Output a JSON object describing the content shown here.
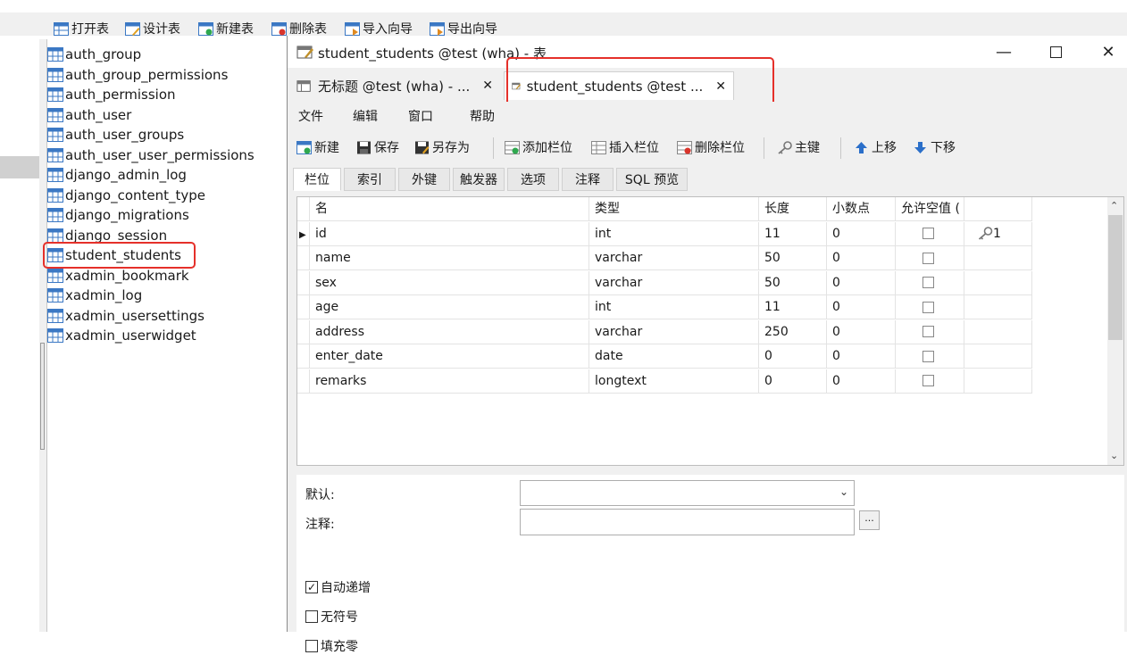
{
  "main_toolbar": {
    "open_table": "打开表",
    "design_table": "设计表",
    "new_table": "新建表",
    "delete_table": "删除表",
    "import_wizard": "导入向导",
    "export_wizard": "导出向导"
  },
  "table_list": [
    "auth_group",
    "auth_group_permissions",
    "auth_permission",
    "auth_user",
    "auth_user_groups",
    "auth_user_user_permissions",
    "django_admin_log",
    "django_content_type",
    "django_migrations",
    "django_session",
    "student_students",
    "xadmin_bookmark",
    "xadmin_log",
    "xadmin_usersettings",
    "xadmin_userwidget"
  ],
  "designer": {
    "window_title": "student_students @test (wha) - 表",
    "tabs": [
      {
        "label": "无标题 @test (wha) - ...",
        "close": "✕"
      },
      {
        "label": "student_students @test ...",
        "close": "✕"
      }
    ],
    "menu": [
      "文件",
      "编辑",
      "窗口",
      "帮助"
    ],
    "toolbar": {
      "new": "新建",
      "save": "保存",
      "save_as": "另存为",
      "add_field": "添加栏位",
      "insert_field": "插入栏位",
      "delete_field": "删除栏位",
      "primary_key": "主键",
      "move_up": "上移",
      "move_down": "下移"
    },
    "sub_tabs": [
      "栏位",
      "索引",
      "外键",
      "触发器",
      "选项",
      "注释",
      "SQL 预览"
    ],
    "grid": {
      "headers": [
        "名",
        "类型",
        "长度",
        "小数点",
        "允许空值 ("
      ],
      "rows": [
        {
          "name": "id",
          "type": "int",
          "length": "11",
          "decimals": "0",
          "key": "1"
        },
        {
          "name": "name",
          "type": "varchar",
          "length": "50",
          "decimals": "0",
          "key": ""
        },
        {
          "name": "sex",
          "type": "varchar",
          "length": "50",
          "decimals": "0",
          "key": ""
        },
        {
          "name": "age",
          "type": "int",
          "length": "11",
          "decimals": "0",
          "key": ""
        },
        {
          "name": "address",
          "type": "varchar",
          "length": "250",
          "decimals": "0",
          "key": ""
        },
        {
          "name": "enter_date",
          "type": "date",
          "length": "0",
          "decimals": "0",
          "key": ""
        },
        {
          "name": "remarks",
          "type": "longtext",
          "length": "0",
          "decimals": "0",
          "key": ""
        }
      ]
    },
    "props": {
      "default_label": "默认:",
      "comment_label": "注释:",
      "browse_label": "...",
      "auto_increment": "自动递增",
      "unsigned": "无符号",
      "zerofill": "填充零"
    }
  },
  "colors": {
    "highlight_red": "#e5302a",
    "window_bg": "#f0f0f0"
  }
}
